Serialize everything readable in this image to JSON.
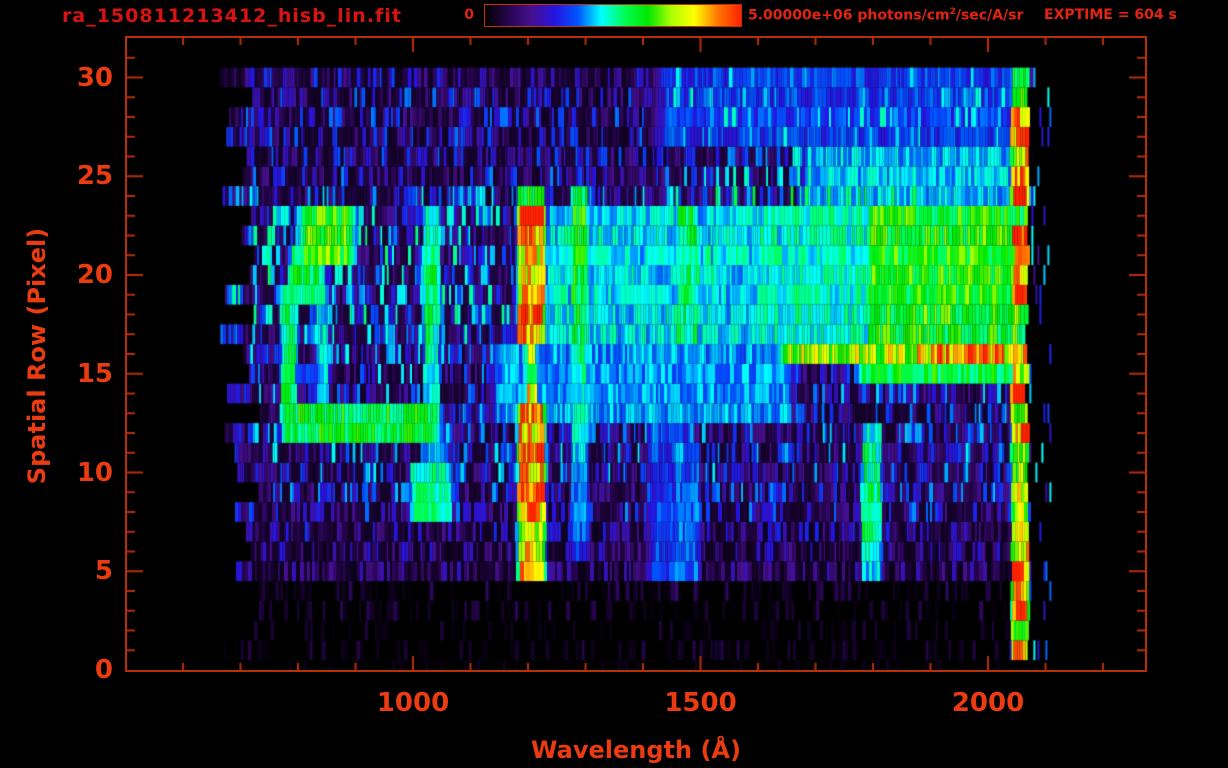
{
  "header": {
    "title": "ra_150811213412_hisb_lin.fit",
    "exptime_label": "EXPTIME = 604 s",
    "colorbar": {
      "min_label": "0",
      "max_value": "5.00000e+06",
      "units_pre": " photons/cm",
      "units_sup": "2",
      "units_post": "/sec/A/sr",
      "gradient_stops": [
        "#000000",
        "#26054e",
        "#46108e",
        "#2414e0",
        "#0055ff",
        "#00ffff",
        "#00ff55",
        "#00e800",
        "#aaff00",
        "#ffff00",
        "#ff7700",
        "#ff2200"
      ]
    }
  },
  "colors": {
    "frame": "#b82f08",
    "tick_label": "#ea3c10",
    "axis_label": "#ea3c10",
    "title": "#d91212",
    "header_label": "#e32410"
  },
  "chart_data": {
    "type": "heatmap",
    "title": "ra_150811213412_hisb_lin.fit",
    "xlabel": "Wavelength (Å)",
    "ylabel": "Spatial Row (Pixel)",
    "x_range": [
      502,
      2273
    ],
    "y_range": [
      0,
      32
    ],
    "x_ticks": [
      1000,
      1500,
      2000
    ],
    "x_minor_step": 100,
    "x_minor_range": [
      600,
      2200
    ],
    "y_ticks": [
      0,
      5,
      10,
      15,
      20,
      25,
      30
    ],
    "y_minor_step": 1,
    "grid": false,
    "colorbar_range": [
      0,
      5000000
    ],
    "colorbar_units": "photons/cm2/sec/A/sr",
    "exposure_seconds": 604,
    "colormap": [
      [
        0,
        "#000000"
      ],
      [
        0.1,
        "#26054e"
      ],
      [
        0.17,
        "#46108e"
      ],
      [
        0.26,
        "#2414e0"
      ],
      [
        0.33,
        "#0055ff"
      ],
      [
        0.43,
        "#00ffff"
      ],
      [
        0.55,
        "#00ff55"
      ],
      [
        0.63,
        "#00e800"
      ],
      [
        0.74,
        "#aaff00"
      ],
      [
        0.82,
        "#ffff00"
      ],
      [
        0.9,
        "#ff7700"
      ],
      [
        1,
        "#ff2200"
      ]
    ],
    "seed": 20150811,
    "data_x_start": 660,
    "data_x_jitter": 75,
    "data_x_end": 2064,
    "rows_base": [
      0.03,
      0.06,
      0.05,
      0.07,
      0.08,
      0.14,
      0.16,
      0.18,
      0.22,
      0.24,
      0.26,
      0.26,
      0.25,
      0.24,
      0.25,
      0.26,
      0.27,
      0.3,
      0.32,
      0.33,
      0.33,
      0.33,
      0.32,
      0.3,
      0.27,
      0.22,
      0.21,
      0.21,
      0.22,
      0.21,
      0.19
    ],
    "features": [
      {
        "name": "lyman-alpha-emission-line",
        "kind": "vline",
        "x": [
          1186,
          1226
        ],
        "rows": [
          4.6,
          24.4
        ],
        "amp": 0.97,
        "soft": 10,
        "waist_rows": [
          13.6,
          16.5
        ],
        "waist_scale": 0.3,
        "row_flicker": 0.45,
        "row_stops": [
          [
            4.6,
            0.62
          ],
          [
            6,
            0.92
          ],
          [
            13,
            0.97
          ],
          [
            14,
            0.82
          ],
          [
            16,
            0.82
          ],
          [
            17,
            0.97
          ],
          [
            23,
            0.97
          ],
          [
            24.4,
            0.72
          ]
        ]
      },
      {
        "name": "emission-line-1290",
        "kind": "vline",
        "x": [
          1278,
          1302
        ],
        "rows": [
          5.6,
          24.5
        ],
        "amp": 0.6,
        "soft": 8,
        "row_stops": [
          [
            5.6,
            0.3
          ],
          [
            12,
            0.42
          ],
          [
            19,
            0.58
          ],
          [
            24.5,
            0.62
          ]
        ]
      },
      {
        "name": "emission-line-1030",
        "kind": "vline",
        "x": [
          1022,
          1044
        ],
        "rows": [
          8.6,
          23.5
        ],
        "amp": 0.52,
        "soft": 8,
        "row_stops": [
          [
            8.6,
            0.34
          ],
          [
            14,
            0.44
          ],
          [
            19,
            0.55
          ],
          [
            21,
            0.52
          ],
          [
            23.5,
            0.42
          ]
        ]
      },
      {
        "name": "ring-top-blob",
        "kind": "blob",
        "x": [
          812,
          892
        ],
        "rows": [
          20.6,
          23.5
        ],
        "amp": 0.66,
        "soft": 20
      },
      {
        "name": "ring-upper-left-blob",
        "kind": "blob",
        "x": [
          790,
          842
        ],
        "rows": [
          18.6,
          21.5
        ],
        "amp": 0.55,
        "soft": 15
      },
      {
        "name": "ring-left-arc",
        "kind": "vline",
        "x": [
          773,
          796
        ],
        "rows": [
          11.6,
          19.6
        ],
        "amp": 0.52,
        "soft": 8
      },
      {
        "name": "ring-bottom-arc",
        "kind": "blob",
        "x": [
          800,
          1040
        ],
        "rows": [
          11.3,
          13.4
        ],
        "amp": 0.58,
        "soft": 25
      },
      {
        "name": "ring-inner-line",
        "kind": "vline",
        "x": [
          833,
          852
        ],
        "rows": [
          11.6,
          19.5
        ],
        "amp": 0.44,
        "soft": 8
      },
      {
        "name": "cyan-blob-1030-low",
        "kind": "blob",
        "x": [
          1000,
          1062
        ],
        "rows": [
          7.6,
          10.5
        ],
        "amp": 0.5,
        "soft": 15
      },
      {
        "name": "faint-left-column",
        "kind": "vline",
        "x": [
          688,
          700
        ],
        "rows": [
          4.6,
          19.5
        ],
        "amp": 0.27,
        "soft": 6
      },
      {
        "name": "emission-line-1475",
        "kind": "vline",
        "x": [
          1462,
          1492
        ],
        "rows": [
          16.6,
          23.5
        ],
        "amp": 0.55,
        "soft": 10
      },
      {
        "name": "emission-line-1475-low",
        "kind": "vline",
        "x": [
          1455,
          1495
        ],
        "rows": [
          4.6,
          11.5
        ],
        "amp": 0.33,
        "soft": 12
      },
      {
        "name": "column-1615",
        "kind": "vline",
        "x": [
          1598,
          1636
        ],
        "rows": [
          16.6,
          23.5
        ],
        "amp": 0.46,
        "soft": 12
      },
      {
        "name": "mid-upper-band",
        "kind": "band",
        "x": [
          1240,
          1645
        ],
        "rows": [
          16.6,
          23.5
        ],
        "amp": 0.42,
        "soft": 30
      },
      {
        "name": "mid-row-band",
        "kind": "band",
        "x": [
          1150,
          1650
        ],
        "rows": [
          12.6,
          16.5
        ],
        "amp": 0.37,
        "soft": 30
      },
      {
        "name": "pre-block-band",
        "kind": "band",
        "x": [
          1645,
          1795
        ],
        "rows": [
          16.6,
          23.5
        ],
        "amp": 0.47,
        "soft": 20
      },
      {
        "name": "bright-green-block",
        "kind": "band",
        "x": [
          1795,
          2056
        ],
        "rows": [
          16.6,
          23.5
        ],
        "amp": 0.63,
        "soft": 15
      },
      {
        "name": "narrow-bright-line-row16",
        "kind": "hline",
        "x": [
          1652,
          2052
        ],
        "rows": [
          15.6,
          16.5
        ],
        "amp": 0.74,
        "soft": 25
      },
      {
        "name": "narrow-bright-line-row16-hot",
        "kind": "hline",
        "x": [
          1878,
          2030
        ],
        "rows": [
          15.6,
          16.5
        ],
        "amp": 0.88,
        "soft": 20
      },
      {
        "name": "narrow-line-row15",
        "kind": "hline",
        "x": [
          1782,
          2052
        ],
        "rows": [
          14.6,
          15.5
        ],
        "amp": 0.58,
        "soft": 20
      },
      {
        "name": "column-1795-low",
        "kind": "vline",
        "x": [
          1783,
          1813
        ],
        "rows": [
          4.5,
          12.4
        ],
        "amp": 0.55,
        "soft": 8,
        "row_stops": [
          [
            4.5,
            0.38
          ],
          [
            7,
            0.55
          ],
          [
            11,
            0.5
          ],
          [
            12.4,
            0.4
          ]
        ]
      },
      {
        "name": "upper-right-speckle-band",
        "kind": "band",
        "x": [
          1690,
          2062
        ],
        "rows": [
          23.6,
          26.5
        ],
        "amp": 0.4,
        "soft": 30
      },
      {
        "name": "top-right-speckle-band",
        "kind": "band",
        "x": [
          1440,
          2062
        ],
        "rows": [
          26.6,
          30.5
        ],
        "amp": 0.3,
        "soft": 40
      },
      {
        "name": "faint-columns-1450-low",
        "kind": "band",
        "x": [
          1415,
          1480
        ],
        "rows": [
          4.6,
          12.4
        ],
        "amp": 0.3,
        "soft": 20
      },
      {
        "name": "detector-edge-column",
        "kind": "vline",
        "x": [
          2042,
          2070
        ],
        "rows": [
          0.6,
          30.5
        ],
        "amp": 0.8,
        "soft": 4,
        "hot_rows": [
          [
            2.6,
            4.5
          ],
          [
            13.6,
            16.5
          ],
          [
            18.6,
            21.5
          ],
          [
            26.6,
            28.5
          ]
        ],
        "hot_amp": 1.0,
        "row_flicker": 0.5
      },
      {
        "name": "beyond-edge-speckle",
        "kind": "speckle",
        "x": [
          2072,
          2108
        ],
        "rows": [
          1,
          30
        ],
        "amp": 0.32,
        "density": 0.1
      }
    ]
  }
}
